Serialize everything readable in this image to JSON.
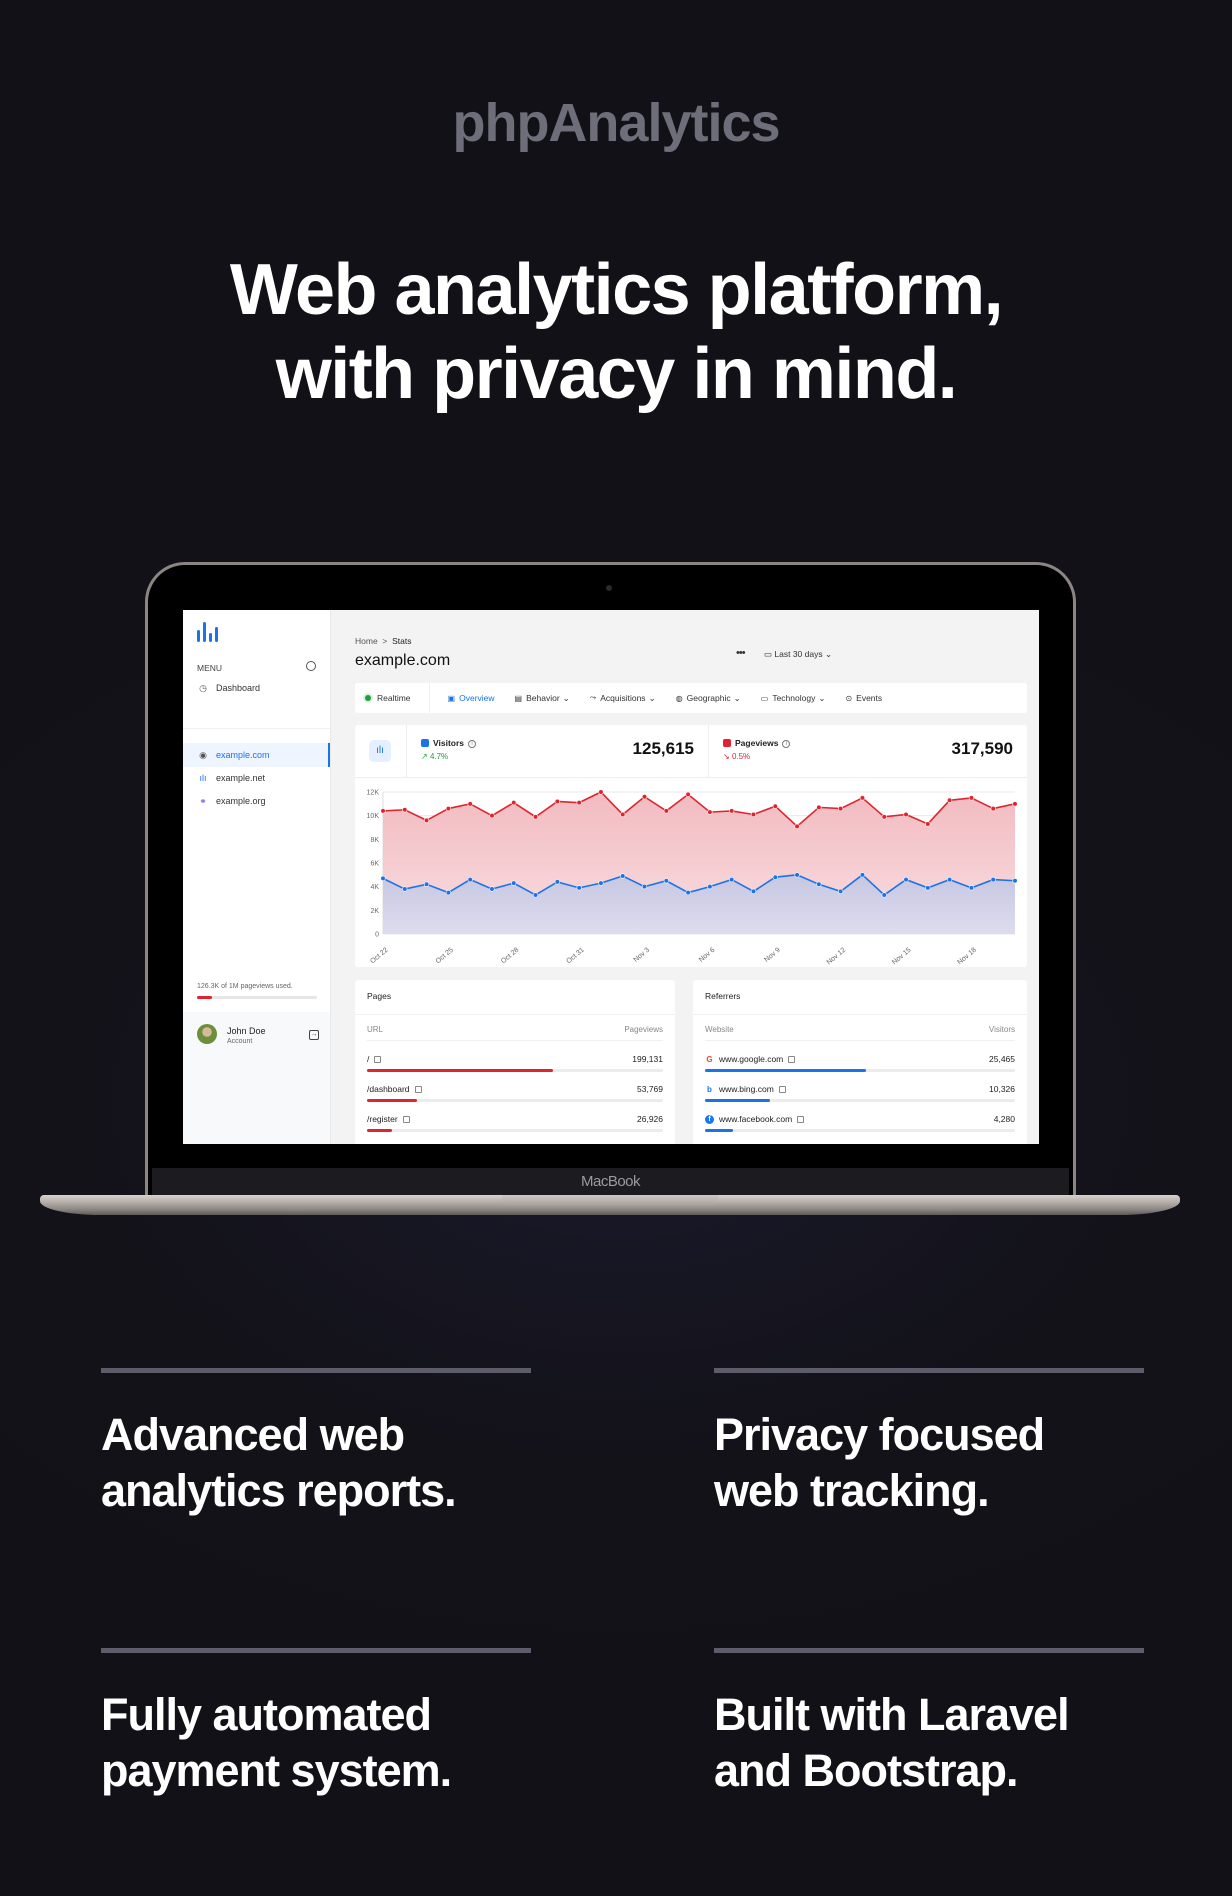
{
  "brand": "phpAnalytics",
  "headline": {
    "line1": "Web analytics platform,",
    "line2": "with privacy in mind."
  },
  "device_label": "MacBook",
  "app": {
    "sidebar": {
      "logo_icon": "bar-chart-logo-icon",
      "menu_label": "MENU",
      "menu_icon": "palette-icon",
      "dashboard": {
        "label": "Dashboard",
        "icon": "gauge-icon"
      },
      "websites": [
        {
          "label": "example.com",
          "icon": "globe-icon",
          "active": true
        },
        {
          "label": "example.net",
          "icon": "bar-chart-icon",
          "active": false
        },
        {
          "label": "example.org",
          "icon": "link-icon",
          "active": false
        }
      ],
      "usage": {
        "text": "126.3K of 1M pageviews used.",
        "used_fraction": 0.126
      },
      "account": {
        "name": "John Doe",
        "subtitle": "Account",
        "logout_icon": "logout-icon"
      }
    },
    "breadcrumb": {
      "home": "Home",
      "separator": ">",
      "current": "Stats"
    },
    "page_title": "example.com",
    "more_label": "•••",
    "date_range": {
      "label": "Last 30 days",
      "icon": "calendar-icon"
    },
    "tabs": [
      {
        "label": "Realtime",
        "icon": "live-dot",
        "dropdown": false,
        "active": false
      },
      {
        "label": "Overview",
        "icon": "chart-square-icon",
        "dropdown": false,
        "active": true
      },
      {
        "label": "Behavior",
        "icon": "window-icon",
        "dropdown": true,
        "active": false
      },
      {
        "label": "Acquisitions",
        "icon": "fork-icon",
        "dropdown": true,
        "active": false
      },
      {
        "label": "Geographic",
        "icon": "globe-icon",
        "dropdown": true,
        "active": false
      },
      {
        "label": "Technology",
        "icon": "devices-icon",
        "dropdown": true,
        "active": false
      },
      {
        "label": "Events",
        "icon": "target-icon",
        "dropdown": false,
        "active": false
      }
    ],
    "stats": {
      "visitors": {
        "label": "Visitors",
        "value": "125,615",
        "change": "4.7%",
        "direction": "up",
        "color": "#1a73e8"
      },
      "pageviews": {
        "label": "Pageviews",
        "value": "317,590",
        "change": "0.5%",
        "direction": "down",
        "color": "#e0242f"
      }
    },
    "pages": {
      "title": "Pages",
      "col_url": "URL",
      "col_value": "Pageviews",
      "rows": [
        {
          "url": "/",
          "value": "199,131",
          "fraction": 0.63
        },
        {
          "url": "/dashboard",
          "value": "53,769",
          "fraction": 0.17
        },
        {
          "url": "/register",
          "value": "26,926",
          "fraction": 0.085
        }
      ]
    },
    "referrers": {
      "title": "Referrers",
      "col_site": "Website",
      "col_value": "Visitors",
      "rows": [
        {
          "site": "www.google.com",
          "icon": "google-icon",
          "value": "25,465",
          "fraction": 0.52
        },
        {
          "site": "www.bing.com",
          "icon": "bing-icon",
          "value": "10,326",
          "fraction": 0.21
        },
        {
          "site": "www.facebook.com",
          "icon": "facebook-icon",
          "value": "4,280",
          "fraction": 0.09
        }
      ]
    }
  },
  "features": [
    {
      "line1": "Advanced web",
      "line2": "analytics reports."
    },
    {
      "line1": "Privacy focused",
      "line2": "web tracking."
    },
    {
      "line1": "Fully automated",
      "line2": "payment system."
    },
    {
      "line1": "Built with Laravel",
      "line2": "and Bootstrap."
    }
  ],
  "chart_data": {
    "type": "area",
    "title": "",
    "xlabel": "",
    "ylabel": "",
    "ylim": [
      0,
      12000
    ],
    "yticks": [
      "0",
      "2K",
      "4K",
      "6K",
      "8K",
      "10K",
      "12K"
    ],
    "ytick_values": [
      0,
      2000,
      4000,
      6000,
      8000,
      10000,
      12000
    ],
    "grid": true,
    "x": [
      "Oct 22",
      "Oct 23",
      "Oct 24",
      "Oct 25",
      "Oct 26",
      "Oct 27",
      "Oct 28",
      "Oct 29",
      "Oct 30",
      "Oct 31",
      "Nov 1",
      "Nov 2",
      "Nov 3",
      "Nov 4",
      "Nov 5",
      "Nov 6",
      "Nov 7",
      "Nov 8",
      "Nov 9",
      "Nov 10",
      "Nov 11",
      "Nov 12",
      "Nov 13",
      "Nov 14",
      "Nov 15",
      "Nov 16",
      "Nov 17",
      "Nov 18",
      "Nov 19",
      "Nov 20"
    ],
    "xtick_labels": [
      "Oct 22",
      "Oct 25",
      "Oct 28",
      "Oct 31",
      "Nov 3",
      "Nov 6",
      "Nov 9",
      "Nov 12",
      "Nov 15",
      "Nov 18"
    ],
    "series": [
      {
        "name": "Pageviews",
        "color": "#e0242f",
        "fill": "#f4c4c8",
        "values": [
          10400,
          10500,
          9600,
          10600,
          11000,
          10000,
          11100,
          9900,
          11200,
          11100,
          12000,
          10100,
          11600,
          10400,
          11800,
          10300,
          10400,
          10100,
          10800,
          9100,
          10700,
          10600,
          11500,
          9900,
          10100,
          9300,
          11300,
          11500,
          10600,
          11000
        ]
      },
      {
        "name": "Visitors",
        "color": "#1a73e8",
        "fill": "#cdd0e6",
        "values": [
          4700,
          3800,
          4200,
          3500,
          4600,
          3800,
          4300,
          3300,
          4400,
          3900,
          4300,
          4900,
          4000,
          4500,
          3500,
          4000,
          4600,
          3600,
          4800,
          5000,
          4200,
          3600,
          5000,
          3300,
          4600,
          3900,
          4600,
          3900,
          4600,
          4500
        ]
      }
    ]
  }
}
